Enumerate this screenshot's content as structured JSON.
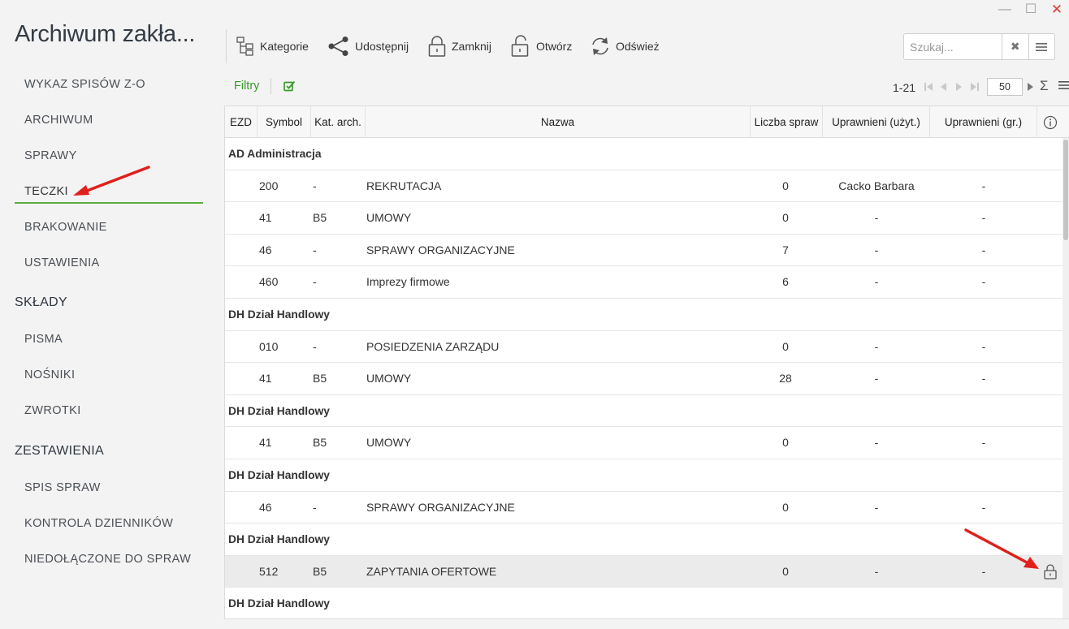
{
  "app": {
    "title": "Archiwum zakła..."
  },
  "window": {
    "minimize": "—",
    "maximize": "☐",
    "close": "✕"
  },
  "sidebar": {
    "items_top": [
      {
        "label": "WYKAZ SPISÓW Z-O"
      },
      {
        "label": "ARCHIWUM"
      },
      {
        "label": "SPRAWY"
      },
      {
        "label": "TECZKI",
        "active": true
      },
      {
        "label": "BRAKOWANIE"
      },
      {
        "label": "USTAWIENIA"
      }
    ],
    "section_sklady": "SKŁADY",
    "items_sklady": [
      {
        "label": "PISMA"
      },
      {
        "label": "NOŚNIKI"
      },
      {
        "label": "ZWROTKI"
      }
    ],
    "section_zestawienia": "ZESTAWIENIA",
    "items_zestawienia": [
      {
        "label": "SPIS SPRAW"
      },
      {
        "label": "KONTROLA DZIENNIKÓW"
      },
      {
        "label": "NIEDOŁĄCZONE DO SPRAW"
      }
    ]
  },
  "toolbar": {
    "kategorie": "Kategorie",
    "udostepnij": "Udostępnij",
    "zamknij": "Zamknij",
    "otworz": "Otwórz",
    "odswiez": "Odśwież"
  },
  "search": {
    "placeholder": "Szukaj...",
    "value": ""
  },
  "filters": {
    "label": "Filtry"
  },
  "pager": {
    "range": "1-21",
    "page_size": "50"
  },
  "grid": {
    "columns": {
      "ezd": "EZD",
      "symbol": "Symbol",
      "kat": "Kat. arch.",
      "nazwa": "Nazwa",
      "liczba": "Liczba spraw",
      "upr_uzyt": "Uprawnieni (użyt.)",
      "upr_gr": "Uprawnieni (gr.)"
    },
    "rows": [
      {
        "type": "group",
        "label": "AD Administracja"
      },
      {
        "type": "data",
        "symbol": "200",
        "kat": "-",
        "nazwa": "REKRUTACJA",
        "liczba": "0",
        "upr_uzyt": "Cacko Barbara",
        "upr_gr": "-"
      },
      {
        "type": "data",
        "symbol": "41",
        "kat": "B5",
        "nazwa": "UMOWY",
        "liczba": "0",
        "upr_uzyt": "-",
        "upr_gr": "-"
      },
      {
        "type": "data",
        "symbol": "46",
        "kat": "-",
        "nazwa": "SPRAWY ORGANIZACYJNE",
        "liczba": "7",
        "upr_uzyt": "-",
        "upr_gr": "-"
      },
      {
        "type": "data",
        "symbol": "460",
        "kat": "-",
        "nazwa": "Imprezy firmowe",
        "liczba": "6",
        "upr_uzyt": "-",
        "upr_gr": "-"
      },
      {
        "type": "group",
        "label": "DH Dział Handlowy"
      },
      {
        "type": "data",
        "symbol": "010",
        "kat": "-",
        "nazwa": "POSIEDZENIA ZARZĄDU",
        "liczba": "0",
        "upr_uzyt": "-",
        "upr_gr": "-"
      },
      {
        "type": "data",
        "symbol": "41",
        "kat": "B5",
        "nazwa": "UMOWY",
        "liczba": "28",
        "upr_uzyt": "-",
        "upr_gr": "-"
      },
      {
        "type": "group",
        "label": "DH Dział Handlowy"
      },
      {
        "type": "data",
        "symbol": "41",
        "kat": "B5",
        "nazwa": "UMOWY",
        "liczba": "0",
        "upr_uzyt": "-",
        "upr_gr": "-"
      },
      {
        "type": "group",
        "label": "DH Dział Handlowy"
      },
      {
        "type": "data",
        "symbol": "46",
        "kat": "-",
        "nazwa": "SPRAWY ORGANIZACYJNE",
        "liczba": "0",
        "upr_uzyt": "-",
        "upr_gr": "-"
      },
      {
        "type": "group",
        "label": "DH Dział Handlowy"
      },
      {
        "type": "data",
        "symbol": "512",
        "kat": "B5",
        "nazwa": "ZAPYTANIA OFERTOWE",
        "liczba": "0",
        "upr_uzyt": "-",
        "upr_gr": "-",
        "selected": true,
        "locked": true
      },
      {
        "type": "group",
        "label": "DH Dział Handlowy"
      }
    ]
  },
  "colors": {
    "accent_green": "#5aae3c",
    "filter_green": "#3a9a2a",
    "arrow_red": "#e0201b"
  }
}
